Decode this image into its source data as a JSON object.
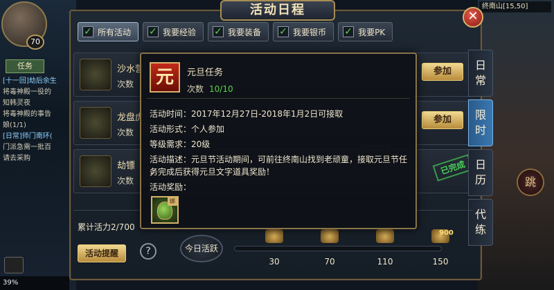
{
  "hud": {
    "level": "70",
    "quest_tab": "任务",
    "quest_lines": [
      {
        "text": "[十一回]劫后余生",
        "highlight": true
      },
      {
        "text": "将毒神殿一役的",
        "highlight": false
      },
      {
        "text": "知韩灵夜",
        "highlight": false
      },
      {
        "text": "将毒神殿的事告",
        "highlight": false
      },
      {
        "text": "娘(1/1)",
        "highlight": false
      },
      {
        "text": "[日常]师门南环(",
        "highlight": true
      },
      {
        "text": "门派急需一批百",
        "highlight": false
      },
      {
        "text": "请去采购",
        "highlight": false
      }
    ],
    "minimap_location": "终南山[15,50]",
    "battery": "39%",
    "skill_glyph": "跳"
  },
  "panel": {
    "title": "活动日程",
    "close_glyph": "✕",
    "filters": [
      {
        "label": "所有活动",
        "checked": true,
        "active": true
      },
      {
        "label": "我要经验",
        "checked": true,
        "active": false
      },
      {
        "label": "我要装备",
        "checked": true,
        "active": false
      },
      {
        "label": "我要银币",
        "checked": true,
        "active": false
      },
      {
        "label": "我要PK",
        "checked": true,
        "active": false
      }
    ],
    "activities": [
      {
        "name": "沙水营",
        "count_label": "次数",
        "action": "参加"
      },
      {
        "name": "龙盘虎",
        "count_label": "次数",
        "action": "参加"
      },
      {
        "name": "劫镖",
        "count_label": "次数",
        "status": "已完成"
      }
    ],
    "side_tabs": [
      {
        "chars": [
          "日",
          "常"
        ],
        "active": false
      },
      {
        "chars": [
          "限",
          "时"
        ],
        "active": true
      },
      {
        "chars": [
          "日",
          "历"
        ],
        "active": false
      },
      {
        "chars": [
          "代",
          "练"
        ],
        "active": false
      }
    ],
    "vitality_label": "累计活力2/700",
    "reminder_button": "活动提醒",
    "help_glyph": "?",
    "today_label": "今日活跃",
    "progress_fraction": 0.0,
    "milestones": [
      "30",
      "70",
      "110",
      "150"
    ],
    "chest_amount": "900"
  },
  "popup": {
    "icon_glyph": "元",
    "title": "元旦任务",
    "count_label": "次数",
    "count_value": "10/10",
    "time": "活动时间：2017年12月27日-2018年1月2日可接取",
    "form": "活动形式：个人参加",
    "level": "等级需求：20级",
    "desc_line1": "活动描述：元旦节活动期间，可前往终南山找到老顽童，接取元旦节任务",
    "desc_line2": "，完成后获得元旦文字道具奖励！",
    "reward_label": "活动奖励：",
    "reward_tag": "绑"
  },
  "colors": {
    "accent_gold": "#d6b36a",
    "active_tab_blue": "#3a78b0",
    "count_green": "#5ad44a",
    "stamp_green": "#4ad05a"
  }
}
